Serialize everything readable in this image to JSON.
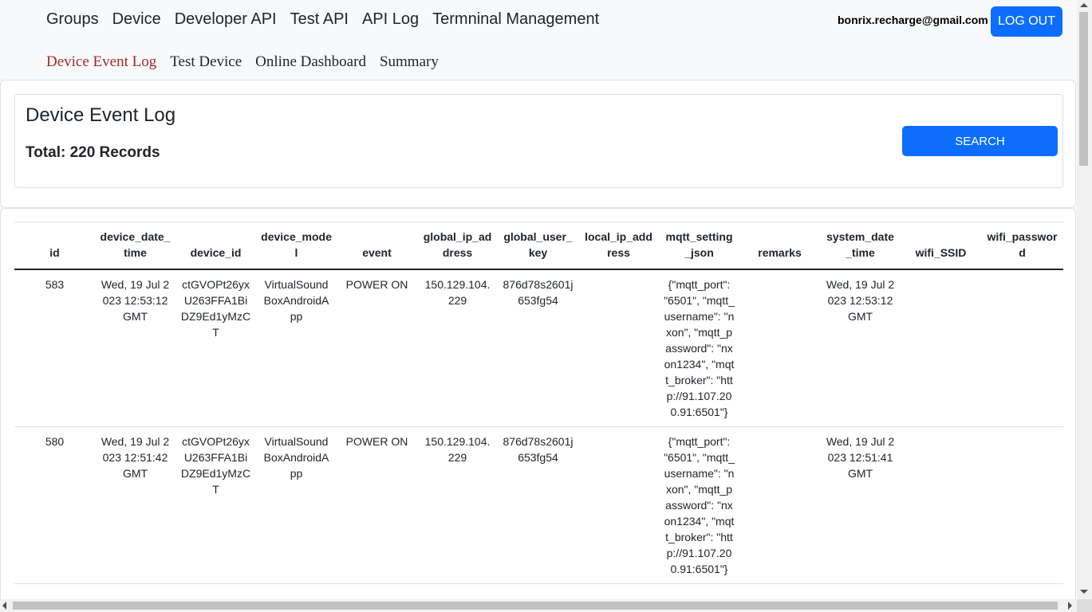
{
  "nav": {
    "main": [
      "Groups",
      "Device",
      "Developer API",
      "Test API",
      "API Log",
      "Termninal Management"
    ],
    "sub": [
      "Device Event Log",
      "Test Device",
      "Online Dashboard",
      "Summary"
    ],
    "active_sub": "Device Event Log",
    "user_email": "bonrix.recharge@gmail.com",
    "logout_label": "LOG OUT"
  },
  "header": {
    "title": "Device Event Log",
    "total": "Total: 220 Records",
    "search_label": "SEARCH"
  },
  "table": {
    "columns": [
      "id",
      "device_date_time",
      "device_id",
      "device_model",
      "event",
      "global_ip_address",
      "global_user_key",
      "local_ip_address",
      "mqtt_setting_json",
      "remarks",
      "system_date_time",
      "wifi_SSID",
      "wifi_password"
    ],
    "rows": [
      {
        "id": "583",
        "device_date_time": "Wed, 19 Jul 2023 12:53:12 GMT",
        "device_id": "ctGVOPt26yxU263FFA1BiDZ9Ed1yMzCT",
        "device_model": "VirtualSoundBoxAndroidApp",
        "event": "POWER ON",
        "global_ip_address": "150.129.104.229",
        "global_user_key": "876d78s2601j653fg54",
        "local_ip_address": "",
        "mqtt_setting_json": "{\"mqtt_port\": \"6501\", \"mqtt_username\": \"nxon\", \"mqtt_password\": \"nxon1234\", \"mqtt_broker\": \"http://91.107.200.91:6501\"}",
        "remarks": "",
        "system_date_time": "Wed, 19 Jul 2023 12:53:12 GMT",
        "wifi_SSID": "",
        "wifi_password": ""
      },
      {
        "id": "580",
        "device_date_time": "Wed, 19 Jul 2023 12:51:42 GMT",
        "device_id": "ctGVOPt26yxU263FFA1BiDZ9Ed1yMzCT",
        "device_model": "VirtualSoundBoxAndroidApp",
        "event": "POWER ON",
        "global_ip_address": "150.129.104.229",
        "global_user_key": "876d78s2601j653fg54",
        "local_ip_address": "",
        "mqtt_setting_json": "{\"mqtt_port\": \"6501\", \"mqtt_username\": \"nxon\", \"mqtt_password\": \"nxon1234\", \"mqtt_broker\": \"http://91.107.200.91:6501\"}",
        "remarks": "",
        "system_date_time": "Wed, 19 Jul 2023 12:51:41 GMT",
        "wifi_SSID": "",
        "wifi_password": ""
      }
    ]
  }
}
